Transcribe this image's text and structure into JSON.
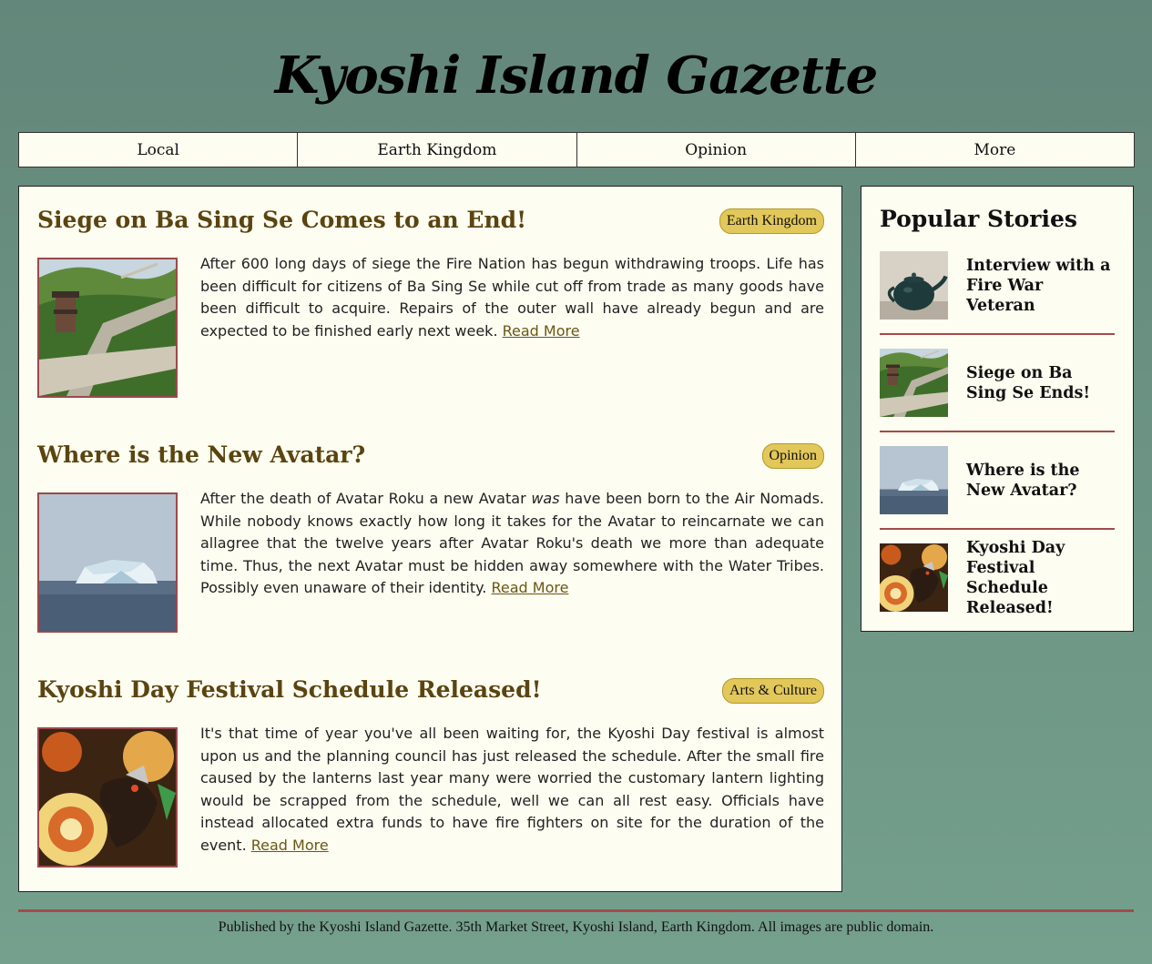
{
  "site": {
    "title": "Kyoshi Island Gazette"
  },
  "nav": {
    "items": [
      "Local",
      "Earth Kingdom",
      "Opinion",
      "More"
    ]
  },
  "articles": [
    {
      "title": "Siege on Ba Sing Se Comes to an End!",
      "tag": "Earth Kingdom",
      "image_icon": "great-wall-photo",
      "body_before": "After 600 long days of siege the Fire Nation has begun withdrawing troops. Life has been difficult for citizens of Ba Sing Se while cut off from trade as many goods have been difficult to acquire. Repairs of the outer wall have already begun and are expected to be finished early next week.",
      "body_italic": "",
      "body_after": "",
      "read_more": "Read More"
    },
    {
      "title": "Where is the New Avatar?",
      "tag": "Opinion",
      "image_icon": "iceberg-photo",
      "body_before": "After the death of Avatar Roku a new Avatar",
      "body_italic": "was",
      "body_after": "have been born to the Air Nomads. While nobody knows exactly how long it takes for the Avatar to reincarnate we can allagree that the twelve years after Avatar Roku's death we more than adequate time. Thus, the next Avatar must be hidden away somewhere with the Water Tribes. Possibly even unaware of their identity.",
      "read_more": "Read More"
    },
    {
      "title": "Kyoshi Day Festival Schedule Released!",
      "tag": "Arts & Culture",
      "image_icon": "dragon-lantern-photo",
      "body_before": "It's that time of year you've all been waiting for, the Kyoshi Day festival is almost upon us and the planning council has just released the schedule. After the small fire caused by the lanterns last year many were worried the customary lantern lighting would be scrapped from the schedule, well we can all rest easy. Officials have instead allocated extra funds to have fire fighters on site for the duration of the event.",
      "body_italic": "",
      "body_after": "",
      "read_more": "Read More"
    }
  ],
  "sidebar": {
    "title": "Popular Stories",
    "items": [
      {
        "title": "Interview with a Fire War Veteran",
        "image_icon": "teapot-photo"
      },
      {
        "title": "Siege on Ba Sing Se Ends!",
        "image_icon": "great-wall-photo"
      },
      {
        "title": "Where is the New Avatar?",
        "image_icon": "iceberg-photo"
      },
      {
        "title": "Kyoshi Day Festival Schedule Released!",
        "image_icon": "dragon-lantern-photo"
      }
    ]
  },
  "footer": {
    "text": "Published by the Kyoshi Island Gazette. 35th Market Street, Kyoshi Island, Earth Kingdom. All images are public domain."
  },
  "colors": {
    "background": "#6a9482",
    "paper": "#fdfdf1",
    "headline": "#5a4410",
    "badge": "#e2c75a",
    "accent_rule": "#a34a4a"
  }
}
